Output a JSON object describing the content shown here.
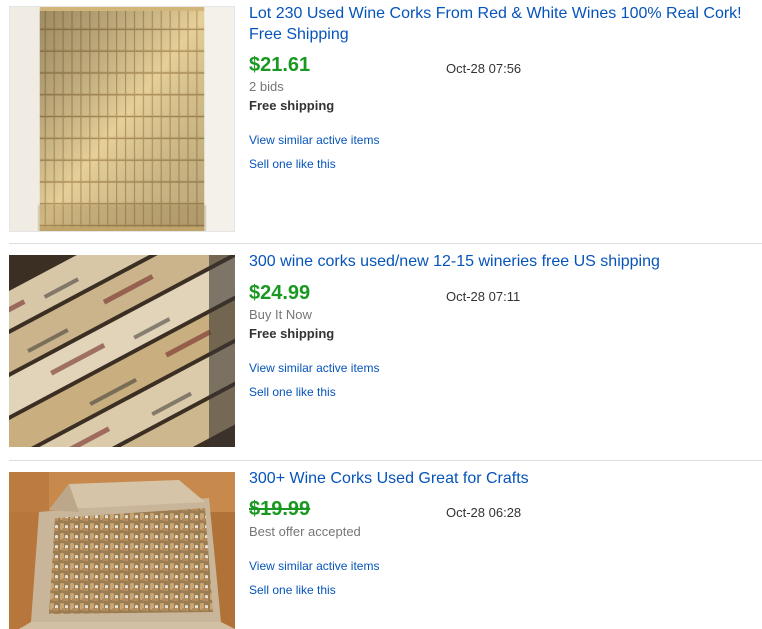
{
  "results": [
    {
      "title": "Lot 230 Used Wine Corks From Red & White Wines 100% Real Cork! Free Shipping",
      "price": "$21.61",
      "time": "Oct-28 07:56",
      "subtext": "2 bids",
      "shipping": "Free shipping",
      "similar_link": "View similar active items",
      "sell_link": "Sell one like this",
      "image_icon": "corks-in-rows-photo"
    },
    {
      "title": "300 wine corks used/new 12-15 wineries free US shipping",
      "price": "$24.99",
      "time": "Oct-28 07:11",
      "subtext": "Buy It Now",
      "shipping": "Free shipping",
      "similar_link": "View similar active items",
      "sell_link": "Sell one like this",
      "image_icon": "branded-corks-closeup-photo"
    },
    {
      "title": "300+ Wine Corks Used Great for Crafts",
      "price": "$19.99",
      "time": "Oct-28 06:28",
      "subtext": "Best offer accepted",
      "similar_link": "View similar active items",
      "sell_link": "Sell one like this",
      "image_icon": "box-of-corks-photo"
    }
  ],
  "colors": {
    "link": "#0654ba",
    "price": "#1a9922",
    "muted": "#767676",
    "divider": "#dddddd"
  }
}
